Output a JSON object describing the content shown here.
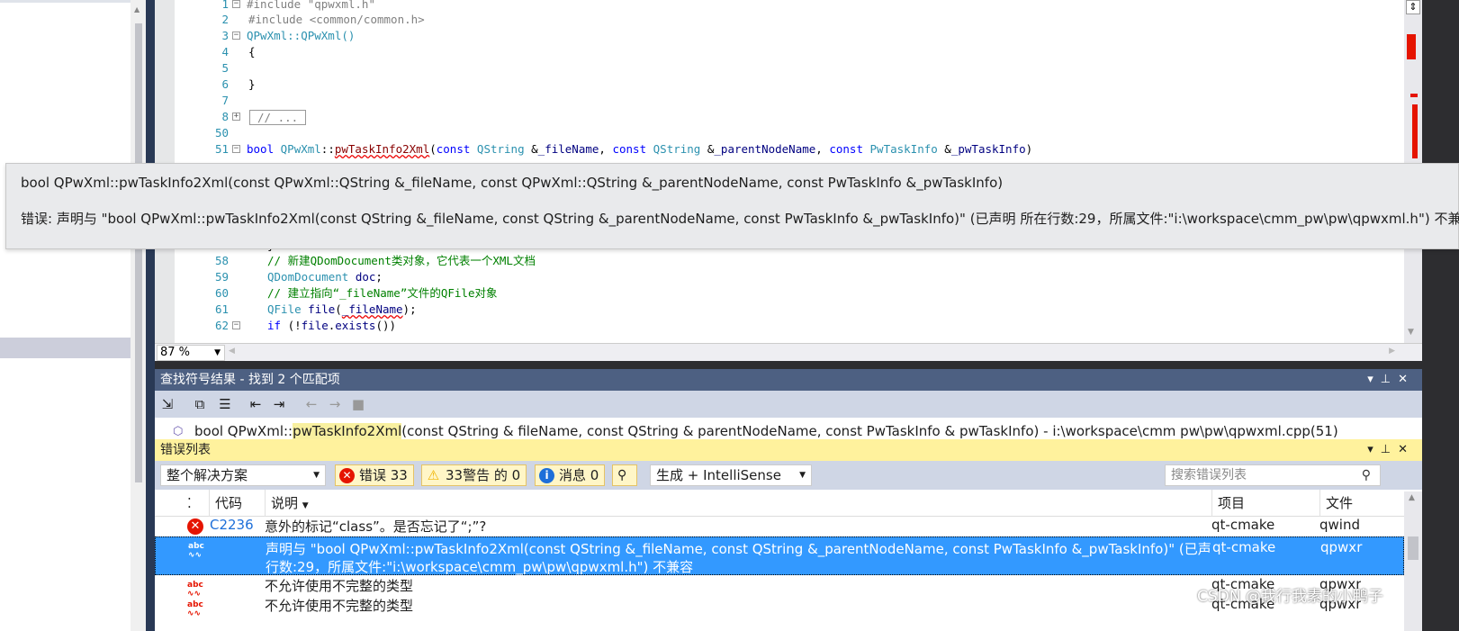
{
  "editor": {
    "lines": [
      {
        "num": "1",
        "code": "#include \"qpwxml.h\""
      },
      {
        "num": "2",
        "code": "#include <common/common.h>"
      },
      {
        "num": "3",
        "code": "QPwXml::QPwXml()"
      },
      {
        "num": "4",
        "code": "{"
      },
      {
        "num": "5",
        "code": ""
      },
      {
        "num": "6",
        "code": "}"
      },
      {
        "num": "7",
        "code": ""
      },
      {
        "num": "8",
        "code": "// ..."
      },
      {
        "num": "50",
        "code": ""
      },
      {
        "num": "51",
        "code": "bool QPwXml::pwTaskInfo2Xml(const QString &_fileName, const QString &_parentNodeName, const PwTaskInfo &_pwTaskInfo)"
      },
      {
        "num": "57",
        "code": "}"
      },
      {
        "num": "58",
        "code": "// 新建QDomDocument类对象，它代表一个XML文档"
      },
      {
        "num": "59",
        "code": "QDomDocument doc;"
      },
      {
        "num": "60",
        "code": "// 建立指向“_fileName”文件的QFile对象"
      },
      {
        "num": "61",
        "code": "QFile file(_fileName);"
      },
      {
        "num": "62",
        "code": "if (!file.exists())"
      }
    ],
    "zoom": "87 %"
  },
  "tooltip": {
    "signature": "bool QPwXml::pwTaskInfo2Xml(const QPwXml::QString &_fileName, const QPwXml::QString &_parentNodeName, const PwTaskInfo &_pwTaskInfo)",
    "error": "错误: 声明与 \"bool QPwXml::pwTaskInfo2Xml(const QString &_fileName, const QString &_parentNodeName, const PwTaskInfo &_pwTaskInfo)\" (已声明 所在行数:29，所属文件:\"i:\\workspace\\cmm_pw\\pw\\qpwxml.h\") 不兼容"
  },
  "find_panel": {
    "title": "查找符号结果 - 找到 2 个匹配项",
    "result_prefix": "bool QPwXml::",
    "result_match": "pwTaskInfo2Xml",
    "result_suffix": "(const QString &  fileName, const QString &  parentNodeName, const PwTaskInfo &  pwTaskInfo) - i:\\workspace\\cmm  pw\\pw\\qpwxml.cpp(51)"
  },
  "error_panel": {
    "title": "错误列表",
    "scope": "整个解决方案",
    "errors_label": "错误 33",
    "warnings_label": "33警告 的 0",
    "messages_label": "消息 0",
    "build_filter": "生成 + IntelliSense",
    "search_placeholder": "搜索错误列表",
    "columns": {
      "code": "代码",
      "description": "说明",
      "project": "项目",
      "file": "文件"
    },
    "rows": [
      {
        "code": "C2236",
        "description": "意外的标记“class”。是否忘记了“;”?",
        "project": "qt-cmake",
        "file": "qwind"
      },
      {
        "code": "",
        "description": "声明与 \"bool QPwXml::pwTaskInfo2Xml(const QString &_fileName, const QString &_parentNodeName, const PwTaskInfo &_pwTaskInfo)\" (已声明 所在",
        "description2": "行数:29，所属文件:\"i:\\workspace\\cmm_pw\\pw\\qpwxml.h\") 不兼容",
        "project": "qt-cmake",
        "file": "qpwxr"
      },
      {
        "code": "",
        "description": "不允许使用不完整的类型",
        "project": "qt-cmake",
        "file": "qpwxr"
      },
      {
        "code": "",
        "description": "不允许使用不完整的类型",
        "project": "qt-cmake",
        "file": "qpwxr"
      }
    ]
  },
  "watermark": "CSDN @我行我素的小鸭子",
  "colors": {
    "accent": "#3399ff",
    "panel_title": "#4d6082",
    "error_title": "#fff29d",
    "error_red": "#e51400"
  }
}
